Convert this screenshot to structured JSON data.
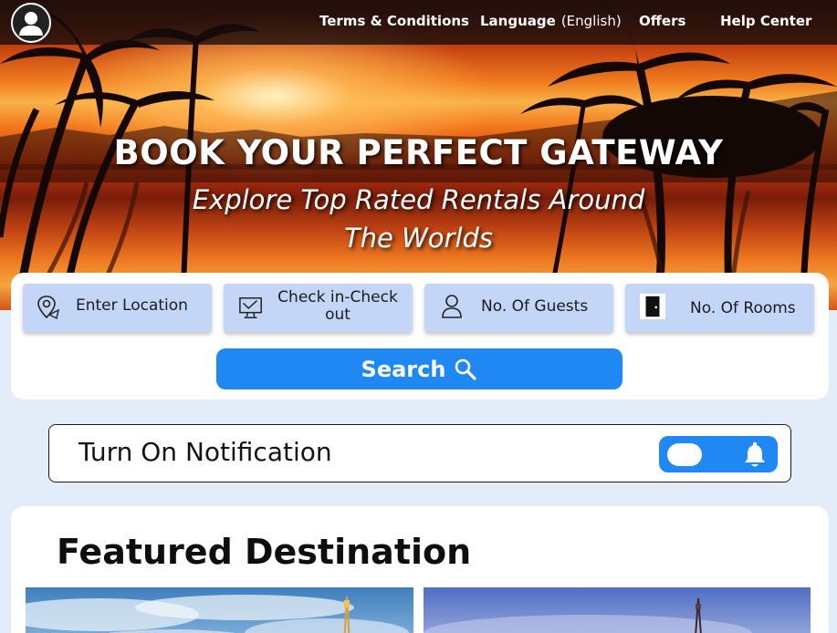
{
  "nav": {
    "terms": "Terms & Conditions",
    "language": "Language",
    "language_value": "(English)",
    "offers": "Offers",
    "help": "Help Center"
  },
  "hero": {
    "title": "BOOK YOUR PERFECT GATEWAY",
    "subtitle_line1": "Explore Top Rated Rentals Around",
    "subtitle_line2": "The Worlds"
  },
  "search": {
    "location_label": "Enter Location",
    "dates_label_line1": "Check in-Check",
    "dates_label_line2": "out",
    "guests_label": "No. Of Guests",
    "rooms_label": "No. Of Rooms",
    "button_label": "Search"
  },
  "notification": {
    "label": "Turn On Notification",
    "enabled": false
  },
  "featured": {
    "title": "Featured Destination"
  },
  "icons": {
    "avatar": "user-avatar-icon",
    "location": "location-pin-icon",
    "calendar": "monitor-check-icon",
    "guests": "person-icon",
    "rooms": "door-icon",
    "search": "search-icon",
    "bell": "bell-icon"
  },
  "colors": {
    "accent": "#1f88f3",
    "field_bg": "#c3d6f8",
    "page_bg": "#e3ecf9"
  }
}
